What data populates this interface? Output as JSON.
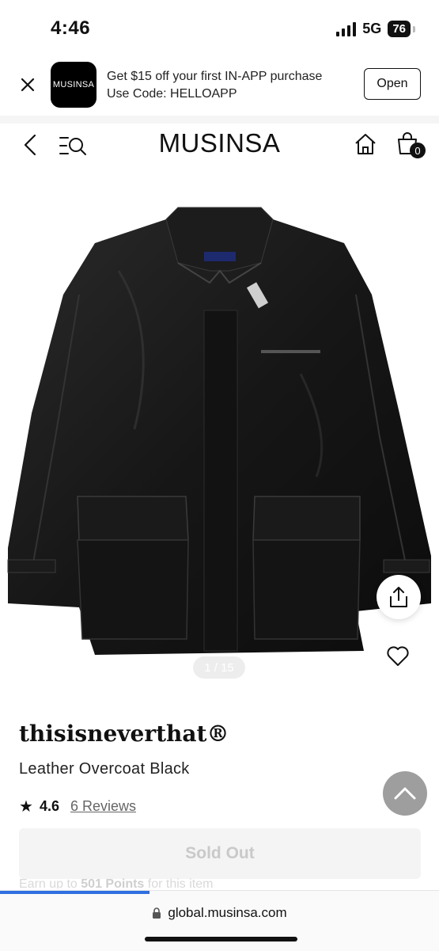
{
  "status_bar": {
    "time": "4:46",
    "network": "5G",
    "battery": "76"
  },
  "promo": {
    "logo_text": "MUSINSA",
    "line1": "Get $15 off your first IN-APP purchase",
    "line2": "Use Code: HELLOAPP",
    "open_label": "Open"
  },
  "header": {
    "brand": "MUSINSA",
    "cart_count": "0"
  },
  "gallery": {
    "counter": "1 / 15"
  },
  "product": {
    "brand": "thisisneverthat®",
    "name": "Leather Overcoat Black",
    "rating": "4.6",
    "reviews": "6 Reviews",
    "button_label": "Sold Out",
    "points_prefix": "Earn up to",
    "points_value": "501 Points",
    "points_suffix": "for this item"
  },
  "browser": {
    "url": "global.musinsa.com",
    "load_progress": 0.34
  },
  "colors": {
    "accent": "#2f6fe0",
    "text": "#111111",
    "disabled_bg": "#f4f4f4"
  }
}
